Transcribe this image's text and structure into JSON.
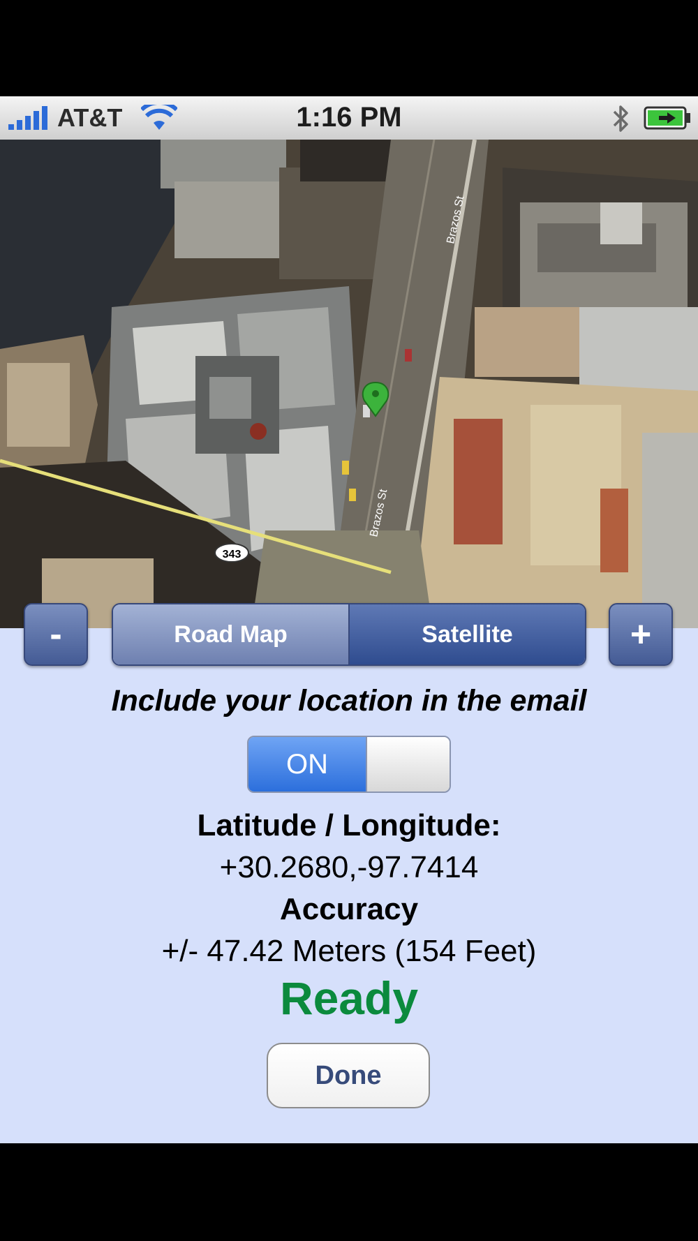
{
  "status_bar": {
    "carrier": "AT&T",
    "time": "1:16 PM",
    "signal_icon": "signal-bars-icon",
    "wifi_icon": "wifi-icon",
    "bluetooth_icon": "bluetooth-icon",
    "battery_icon": "battery-charging-icon"
  },
  "map": {
    "view": "Satellite",
    "streets": [
      "Brazos St",
      "Brazos St"
    ],
    "route_shield": "343",
    "marker_icon": "location-pin-icon",
    "marker_color": "#3cb33c"
  },
  "controls": {
    "zoom_out_label": "-",
    "zoom_in_label": "+",
    "road_map_label": "Road Map",
    "satellite_label": "Satellite",
    "selected": "Satellite"
  },
  "location": {
    "include_label": "Include your location in the email",
    "toggle_label": "ON",
    "toggle_state": true,
    "latlon_heading": "Latitude / Longitude:",
    "latlon_value": "+30.2680,-97.7414",
    "accuracy_heading": "Accuracy",
    "accuracy_value": "+/- 47.42 Meters (154 Feet)",
    "status": "Ready",
    "status_color": "#0b8a3d",
    "done_label": "Done"
  }
}
